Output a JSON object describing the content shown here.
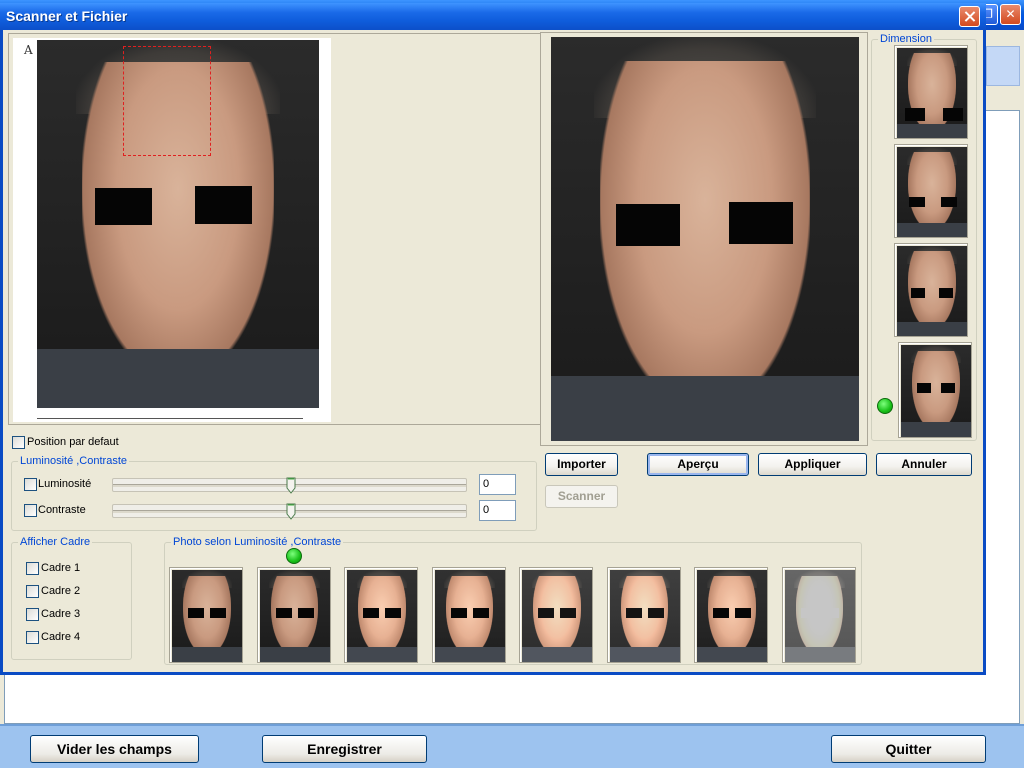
{
  "background_app": {
    "footer": {
      "clear_label": "Vider les champs",
      "save_label": "Enregistrer",
      "quit_label": "Quitter"
    }
  },
  "dialog": {
    "title": "Scanner et Fichier",
    "photo_label": "A",
    "default_position_label": "Position par defaut",
    "brightness_contrast_group": {
      "title": "Luminosité ,Contraste",
      "brightness_label": "Luminosité",
      "brightness_value": "0",
      "contrast_label": "Contraste",
      "contrast_value": "0",
      "brightness_level": 0.5,
      "contrast_level": 0.5
    },
    "frame_group": {
      "title": "Afficher Cadre",
      "items": [
        "Cadre 1",
        "Cadre 2",
        "Cadre 3",
        "Cadre 4"
      ]
    },
    "photo_variants_group": {
      "title": "Photo selon Luminosité ,Contraste",
      "count": 8,
      "selected_index": 1
    },
    "dimension_group": {
      "title": "Dimension",
      "count": 4,
      "selected_index": 3
    },
    "buttons": {
      "import_label": "Importer",
      "preview_label": "Aperçu",
      "apply_label": "Appliquer",
      "cancel_label": "Annuler",
      "scan_label": "Scanner"
    }
  },
  "colors": {
    "title_bar": "#0a4bc4",
    "group_title": "#0046d5",
    "dialog_bg": "#ece9d8",
    "crop_rect": "#e02020",
    "selected_indicator": "#18c018"
  }
}
